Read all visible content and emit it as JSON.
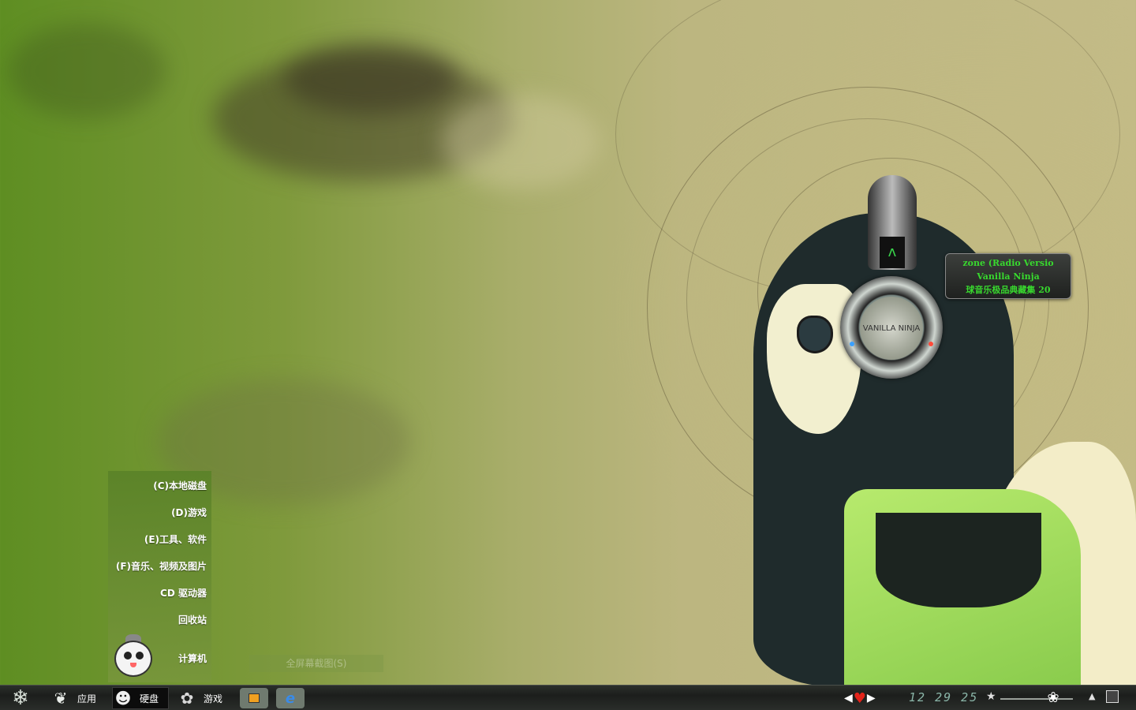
{
  "now_playing": {
    "line1": "zone (Radio Versio",
    "line2": "Vanilla Ninja",
    "line3": "球音乐极品典藏集 20",
    "cover_text": "VANILLA NINJA"
  },
  "drive_menu": {
    "items": [
      {
        "label": "(C)本地磁盘"
      },
      {
        "label": "(D)游戏"
      },
      {
        "label": "(E)工具、软件"
      },
      {
        "label": "(F)音乐、视频及图片"
      },
      {
        "label": "CD 驱动器"
      },
      {
        "label": "回收站"
      },
      {
        "label": "计算机"
      }
    ]
  },
  "ghost_menu": {
    "label": "全屏幕截图(S)"
  },
  "taskbar": {
    "start_icon": "snowflake-icon",
    "buttons": [
      {
        "label": "应用",
        "icon": "butterfly-icon"
      },
      {
        "label": "硬盘",
        "icon": "mascot-icon",
        "active": true
      },
      {
        "label": "游戏",
        "icon": "gear-flower-icon"
      }
    ],
    "quick_launch": [
      {
        "icon": "media-player-icon"
      },
      {
        "icon": "internet-explorer-icon"
      }
    ],
    "clock": "12 29 25",
    "accent": "#6ecb47"
  }
}
